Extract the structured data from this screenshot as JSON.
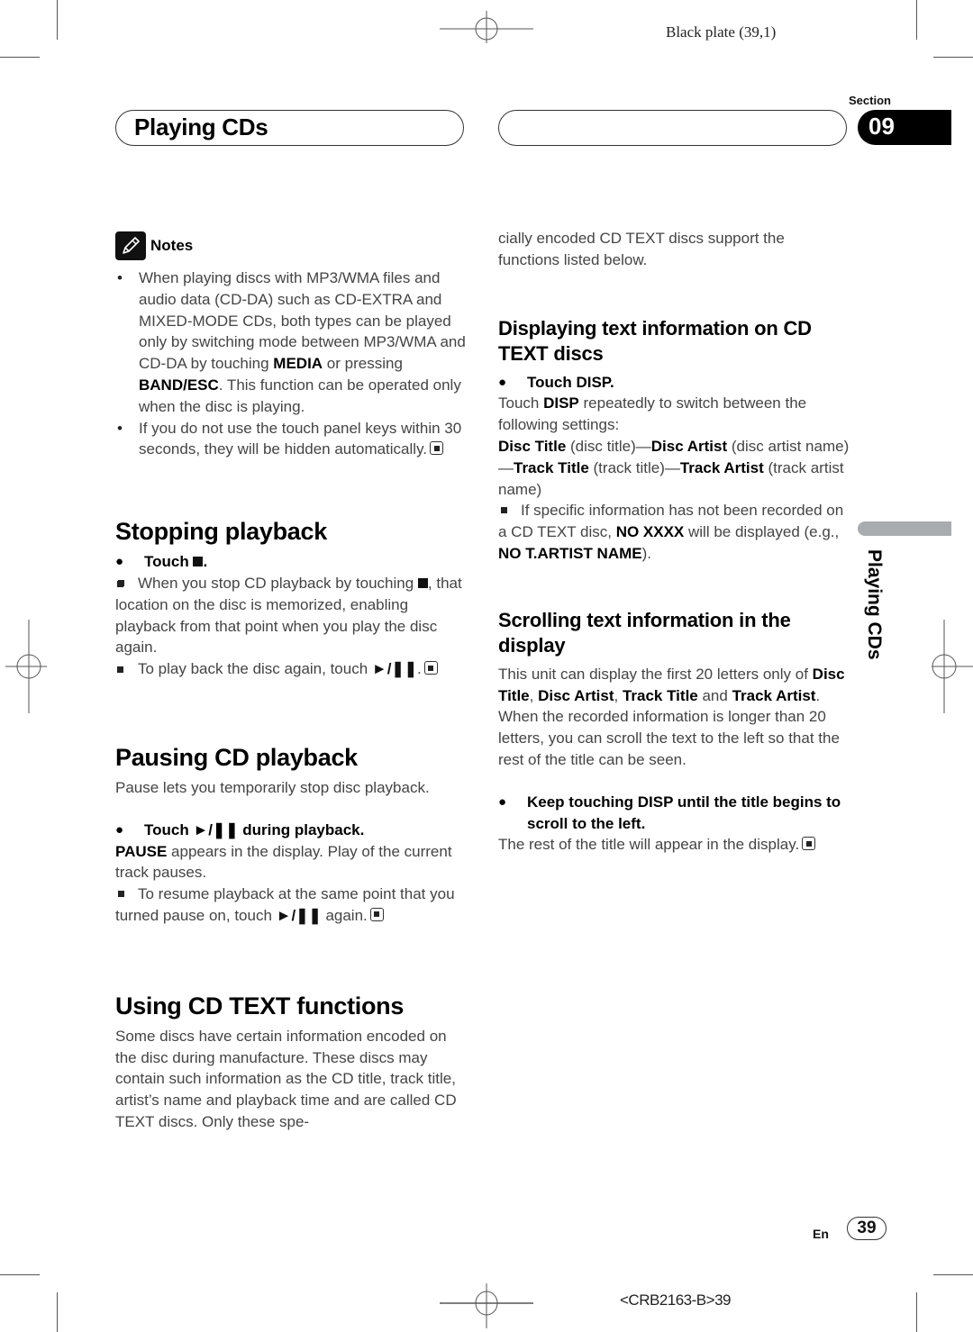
{
  "print": {
    "plate_label": "Black plate (39,1)",
    "doc_code": "<CRB2163-B>39"
  },
  "header": {
    "title": "Playing CDs",
    "section_label": "Section",
    "section_number": "09"
  },
  "sidebar": {
    "label": "Playing CDs"
  },
  "footer": {
    "lang": "En",
    "page": "39"
  },
  "notes": {
    "heading": "Notes",
    "items": [
      {
        "parts": [
          {
            "t": "When playing discs with MP3/WMA files and audio data (CD-DA) such as CD-EXTRA and MIXED-MODE CDs, both types can be played only by switching mode between MP3/WMA and CD-DA by touching "
          },
          {
            "b": "MEDIA"
          },
          {
            "t": " or pressing "
          },
          {
            "b": "BAND/ESC"
          },
          {
            "t": ". This function can be operated only when the disc is playing."
          }
        ]
      },
      {
        "parts": [
          {
            "t": "If you do not use the touch panel keys within 30 seconds, they will be hidden automatically."
          }
        ],
        "end_mark": true
      }
    ]
  },
  "stopping": {
    "heading": "Stopping playback",
    "step_prefix": "Touch",
    "step_suffix": ".",
    "note1_a": "When you stop CD playback by touching",
    "note1_b": ", that location on the disc is memorized, enabling playback from that point when you play the disc again.",
    "note2_a": "To play back the disc again, touch",
    "note2_b": "."
  },
  "pausing": {
    "heading": "Pausing CD playback",
    "intro": "Pause lets you temporarily stop disc playback.",
    "step_prefix": "Touch",
    "step_suffix": "during playback.",
    "result_bold": "PAUSE",
    "result_rest": " appears in the display. Play of the current track pauses.",
    "note_a": "To resume playback at the same point that you turned pause on, touch",
    "note_b": "again."
  },
  "cdtext": {
    "heading": "Using CD TEXT functions",
    "body": "Some discs have certain information encoded on the disc during manufacture. These discs may contain such information as the CD title, track title, artist’s name and playback time and are called CD TEXT discs. Only these spe-",
    "body_cont": "cially encoded CD TEXT discs support the functions listed below."
  },
  "displaying": {
    "heading": "Displaying text information on CD TEXT discs",
    "step": "Touch DISP.",
    "desc_a": "Touch ",
    "desc_b": "DISP",
    "desc_c": " repeatedly to switch between the following settings:",
    "cycle": [
      {
        "b": "Disc Title"
      },
      {
        "t": " (disc title)—"
      },
      {
        "b": "Disc Artist"
      },
      {
        "t": " (disc artist name)—"
      },
      {
        "b": "Track Title"
      },
      {
        "t": " (track title)—"
      },
      {
        "b": "Track Artist"
      },
      {
        "t": " (track artist name)"
      }
    ],
    "note": [
      {
        "t": "If specific information has not been recorded on a CD TEXT disc, "
      },
      {
        "b": "NO XXXX"
      },
      {
        "t": " will be displayed (e.g., "
      },
      {
        "b": "NO T.ARTIST NAME"
      },
      {
        "t": ")."
      }
    ]
  },
  "scrolling": {
    "heading": "Scrolling text information in the display",
    "body": [
      {
        "t": "This unit can display the first 20 letters only of "
      },
      {
        "b": "Disc Title"
      },
      {
        "t": ", "
      },
      {
        "b": "Disc Artist"
      },
      {
        "t": ", "
      },
      {
        "b": "Track Title"
      },
      {
        "t": " and "
      },
      {
        "b": "Track Artist"
      },
      {
        "t": ". When the recorded information is longer than 20 letters, you can scroll the text to the left so that the rest of the title can be seen."
      }
    ],
    "step": "Keep touching DISP until the title begins to scroll to the left.",
    "result": "The rest of the title will appear in the display."
  },
  "glyphs": {
    "play_pause": "►/❚❚"
  }
}
